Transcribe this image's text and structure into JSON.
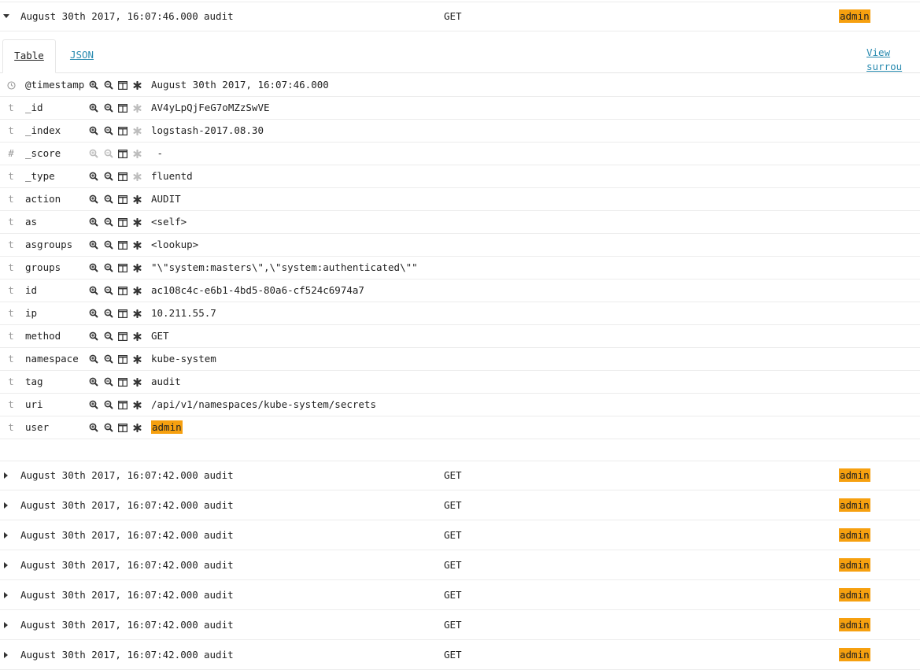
{
  "expanded_row": {
    "time": "August 30th 2017, 16:07:46.000",
    "tag": "audit",
    "method": "GET",
    "user": "admin"
  },
  "tabs": {
    "table": "Table",
    "json": "JSON"
  },
  "view_surrounding": "View surrou",
  "fields": [
    {
      "type": "clock",
      "name": "@timestamp",
      "value": "August 30th 2017, 16:07:46.000",
      "filter_enabled": true,
      "exists_enabled": true,
      "highlight": false
    },
    {
      "type": "t",
      "name": "_id",
      "value": "AV4yLpQjFeG7oMZzSwVE",
      "filter_enabled": true,
      "exists_enabled": false,
      "highlight": false
    },
    {
      "type": "t",
      "name": "_index",
      "value": "logstash-2017.08.30",
      "filter_enabled": true,
      "exists_enabled": false,
      "highlight": false
    },
    {
      "type": "#",
      "name": "_score",
      "value": " -",
      "filter_enabled": false,
      "exists_enabled": false,
      "highlight": false
    },
    {
      "type": "t",
      "name": "_type",
      "value": "fluentd",
      "filter_enabled": true,
      "exists_enabled": false,
      "highlight": false
    },
    {
      "type": "t",
      "name": "action",
      "value": "AUDIT",
      "filter_enabled": true,
      "exists_enabled": true,
      "highlight": false
    },
    {
      "type": "t",
      "name": "as",
      "value": "<self>",
      "filter_enabled": true,
      "exists_enabled": true,
      "highlight": false
    },
    {
      "type": "t",
      "name": "asgroups",
      "value": "<lookup>",
      "filter_enabled": true,
      "exists_enabled": true,
      "highlight": false
    },
    {
      "type": "t",
      "name": "groups",
      "value": "\"\\\"system:masters\\\",\\\"system:authenticated\\\"\"",
      "filter_enabled": true,
      "exists_enabled": true,
      "highlight": false
    },
    {
      "type": "t",
      "name": "id",
      "value": "ac108c4c-e6b1-4bd5-80a6-cf524c6974a7",
      "filter_enabled": true,
      "exists_enabled": true,
      "highlight": false
    },
    {
      "type": "t",
      "name": "ip",
      "value": "10.211.55.7",
      "filter_enabled": true,
      "exists_enabled": true,
      "highlight": false
    },
    {
      "type": "t",
      "name": "method",
      "value": "GET",
      "filter_enabled": true,
      "exists_enabled": true,
      "highlight": false
    },
    {
      "type": "t",
      "name": "namespace",
      "value": "kube-system",
      "filter_enabled": true,
      "exists_enabled": true,
      "highlight": false
    },
    {
      "type": "t",
      "name": "tag",
      "value": "audit",
      "filter_enabled": true,
      "exists_enabled": true,
      "highlight": false
    },
    {
      "type": "t",
      "name": "uri",
      "value": "/api/v1/namespaces/kube-system/secrets",
      "filter_enabled": true,
      "exists_enabled": true,
      "highlight": false
    },
    {
      "type": "t",
      "name": "user",
      "value": "admin",
      "filter_enabled": true,
      "exists_enabled": true,
      "highlight": true
    }
  ],
  "collapsed_rows": [
    {
      "time": "August 30th 2017, 16:07:42.000",
      "tag": "audit",
      "method": "GET",
      "user": "admin"
    },
    {
      "time": "August 30th 2017, 16:07:42.000",
      "tag": "audit",
      "method": "GET",
      "user": "admin"
    },
    {
      "time": "August 30th 2017, 16:07:42.000",
      "tag": "audit",
      "method": "GET",
      "user": "admin"
    },
    {
      "time": "August 30th 2017, 16:07:42.000",
      "tag": "audit",
      "method": "GET",
      "user": "admin"
    },
    {
      "time": "August 30th 2017, 16:07:42.000",
      "tag": "audit",
      "method": "GET",
      "user": "admin"
    },
    {
      "time": "August 30th 2017, 16:07:42.000",
      "tag": "audit",
      "method": "GET",
      "user": "admin"
    },
    {
      "time": "August 30th 2017, 16:07:42.000",
      "tag": "audit",
      "method": "GET",
      "user": "admin"
    }
  ],
  "colors": {
    "highlight": "#f6a00f",
    "link": "#2a8bb0",
    "icon": "#333333",
    "icon_disabled": "#bdbdbd"
  }
}
